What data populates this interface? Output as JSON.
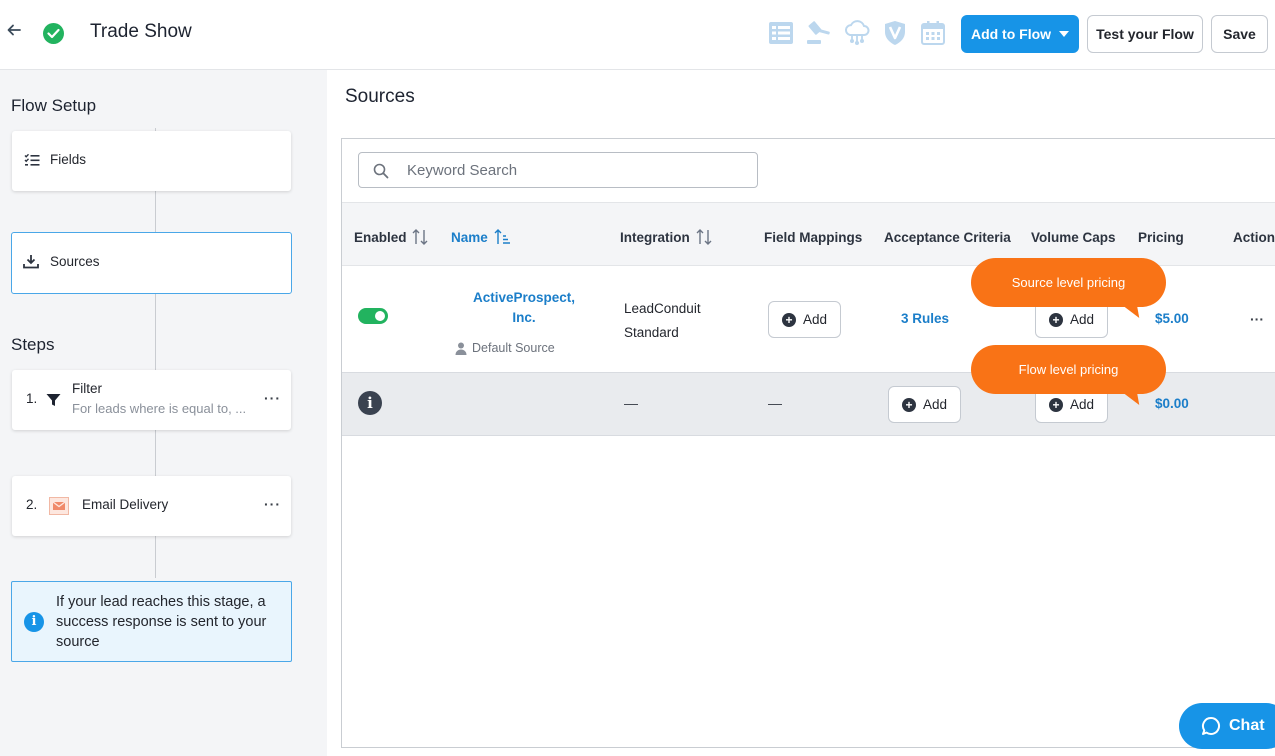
{
  "header": {
    "title": "Trade Show",
    "add_to_flow_label": "Add to Flow",
    "test_flow_label": "Test your Flow",
    "save_label": "Save",
    "toolbar_icons": [
      "list-icon",
      "gavel-icon",
      "cloud-network-icon",
      "verified-v-icon",
      "calendar-icon"
    ]
  },
  "sidebar": {
    "flow_setup_heading": "Flow Setup",
    "fields_label": "Fields",
    "sources_label": "Sources",
    "steps_heading": "Steps",
    "steps": [
      {
        "number": "1.",
        "title": "Filter",
        "subtitle": "For leads where is equal to, ..."
      },
      {
        "number": "2.",
        "title": "Email Delivery"
      }
    ],
    "info_text": "If your lead reaches this stage, a success response is sent to your source"
  },
  "main": {
    "title": "Sources",
    "search_placeholder": "Keyword Search",
    "columns": [
      "Enabled",
      "Name",
      "Integration",
      "Field Mappings",
      "Acceptance Criteria",
      "Volume Caps",
      "Pricing",
      "Actions"
    ],
    "rows": [
      {
        "enabled": true,
        "name": "ActiveProspect, Inc.",
        "name_line1": "ActiveProspect,",
        "name_line2": "Inc.",
        "default_label": "Default Source",
        "integration_line1": "LeadConduit",
        "integration_line2": "Standard",
        "field_mappings": "Add",
        "acceptance_criteria": "3 Rules",
        "volume_caps": "Add",
        "pricing": "$5.00",
        "actions": "···"
      },
      {
        "integration": "—",
        "field_mappings": "—",
        "acceptance_criteria": "Add",
        "volume_caps": "Add",
        "pricing": "$0.00"
      }
    ],
    "callouts": {
      "source_level": "Source level pricing",
      "flow_level": "Flow level pricing"
    }
  },
  "chat_label": "Chat",
  "colors": {
    "primary": "#1794e7",
    "success": "#22b35f",
    "callout": "#f97316",
    "link": "#1b7ec9"
  }
}
